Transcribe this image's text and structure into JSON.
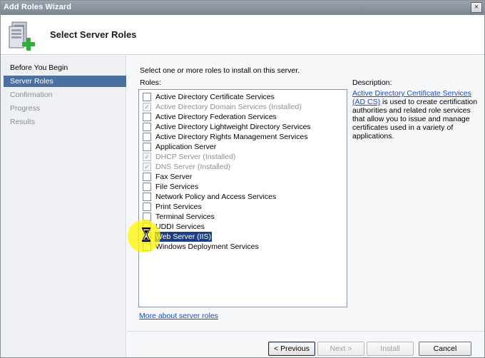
{
  "window": {
    "title": "Add Roles Wizard",
    "close_glyph": "×"
  },
  "header": {
    "title": "Select Server Roles",
    "icon": "server-add-icon"
  },
  "nav": {
    "items": [
      {
        "label": "Before You Begin",
        "state": "done"
      },
      {
        "label": "Server Roles",
        "state": "active"
      },
      {
        "label": "Confirmation",
        "state": "disabled"
      },
      {
        "label": "Progress",
        "state": "disabled"
      },
      {
        "label": "Results",
        "state": "disabled"
      }
    ]
  },
  "main": {
    "instruction": "Select one or more roles to install on this server.",
    "roles_label": "Roles:",
    "description_label": "Description:",
    "roles": [
      {
        "label": "Active Directory Certificate Services",
        "checked": false,
        "disabled": false
      },
      {
        "label": "Active Directory Domain Services  (Installed)",
        "checked": true,
        "disabled": true
      },
      {
        "label": "Active Directory Federation Services",
        "checked": false,
        "disabled": false
      },
      {
        "label": "Active Directory Lightweight Directory Services",
        "checked": false,
        "disabled": false
      },
      {
        "label": "Active Directory Rights Management Services",
        "checked": false,
        "disabled": false
      },
      {
        "label": "Application Server",
        "checked": false,
        "disabled": false
      },
      {
        "label": "DHCP Server  (Installed)",
        "checked": true,
        "disabled": true
      },
      {
        "label": "DNS Server  (Installed)",
        "checked": true,
        "disabled": true
      },
      {
        "label": "Fax Server",
        "checked": false,
        "disabled": false
      },
      {
        "label": "File Services",
        "checked": false,
        "disabled": false
      },
      {
        "label": "Network Policy and Access Services",
        "checked": false,
        "disabled": false
      },
      {
        "label": "Print Services",
        "checked": false,
        "disabled": false
      },
      {
        "label": "Terminal Services",
        "checked": false,
        "disabled": false
      },
      {
        "label": "UDDI Services",
        "checked": false,
        "disabled": false
      },
      {
        "label": "Web Server (IIS)",
        "checked": false,
        "disabled": false,
        "selected": true
      },
      {
        "label": "Windows Deployment Services",
        "checked": false,
        "disabled": false
      }
    ],
    "description": {
      "link": "Active Directory Certificate Services (AD CS)",
      "text": " is used to create certification authorities and related role services that allow you to issue and manage certificates used in a variety of applications."
    },
    "more_link": "More about server roles"
  },
  "buttons": {
    "previous": "< Previous",
    "next": "Next >",
    "install": "Install",
    "cancel": "Cancel"
  },
  "colors": {
    "accent": "#4a6fa0",
    "selection": "#1c3f82",
    "link": "#1a4ec1",
    "highlight": "#fff500"
  }
}
